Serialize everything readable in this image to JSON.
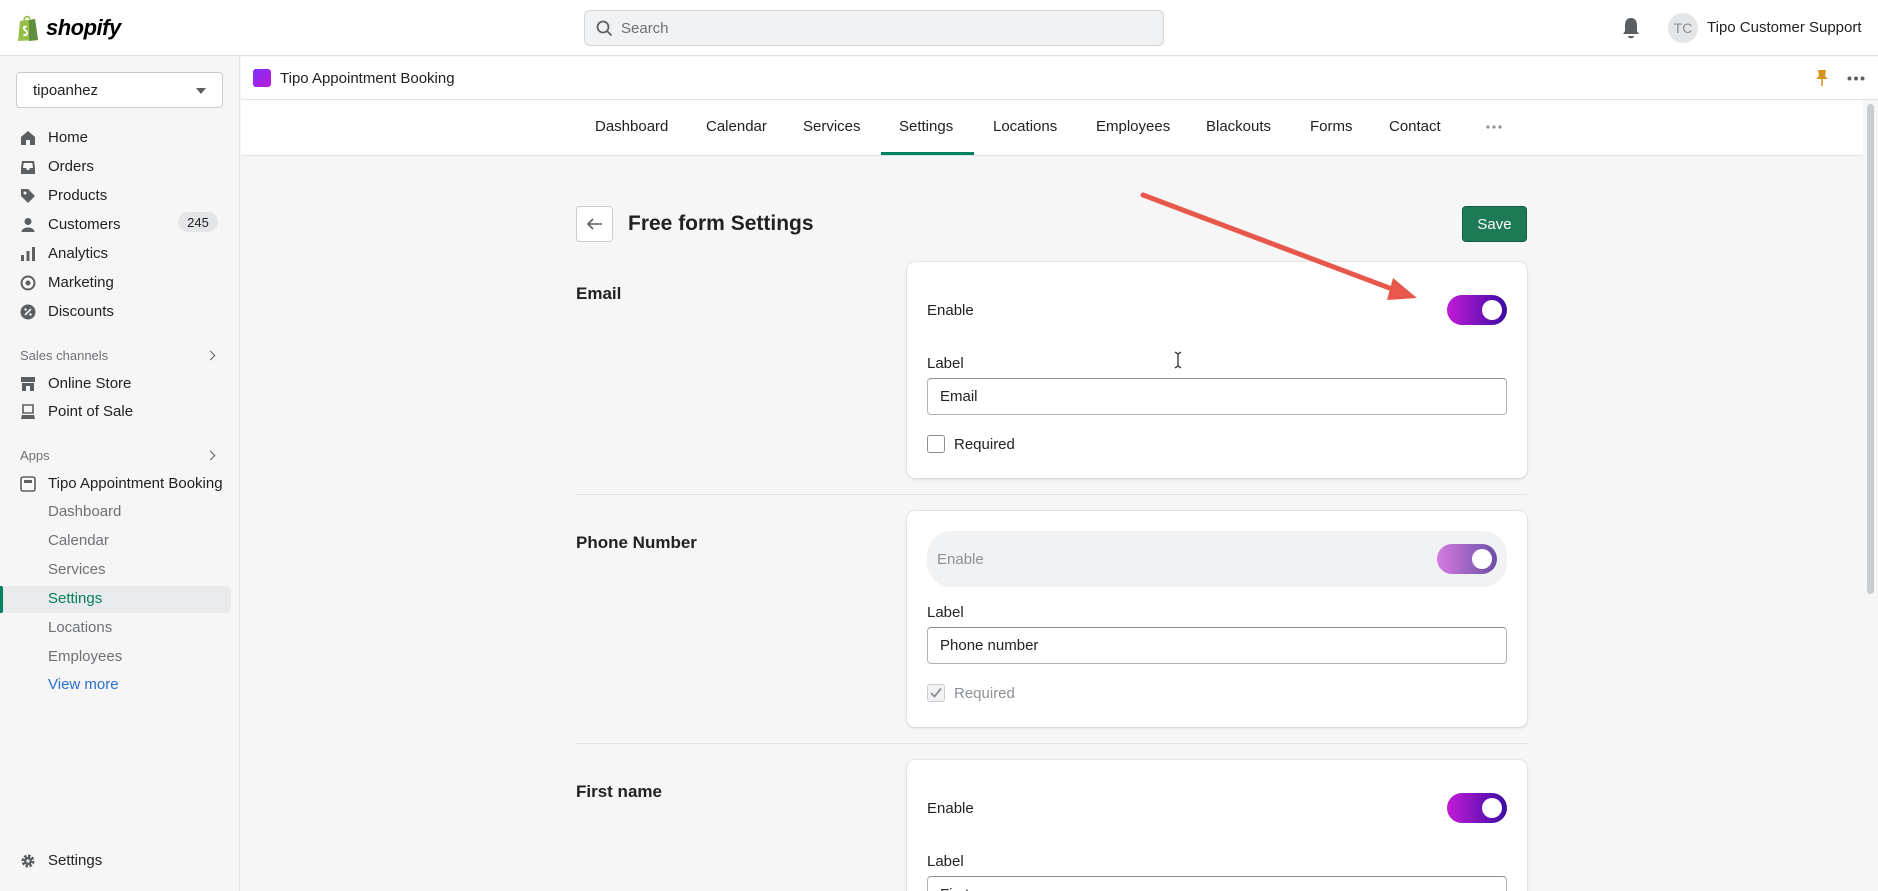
{
  "topbar": {
    "brand": "shopify",
    "search_placeholder": "Search",
    "avatar_initials": "TC",
    "account_name": "Tipo Customer Support"
  },
  "sidebar": {
    "store": "tipoanhez",
    "main_items": [
      {
        "label": "Home",
        "icon": "home-icon"
      },
      {
        "label": "Orders",
        "icon": "orders-icon",
        "badge": "245"
      },
      {
        "label": "Products",
        "icon": "tag-icon"
      },
      {
        "label": "Customers",
        "icon": "person-icon"
      },
      {
        "label": "Analytics",
        "icon": "bar-chart-icon"
      },
      {
        "label": "Marketing",
        "icon": "target-icon"
      },
      {
        "label": "Discounts",
        "icon": "discount-icon"
      }
    ],
    "sales_channels_label": "Sales channels",
    "sales_channels": [
      {
        "label": "Online Store",
        "icon": "store-icon"
      },
      {
        "label": "Point of Sale",
        "icon": "pos-icon"
      }
    ],
    "apps_label": "Apps",
    "app_name": "Tipo Appointment Booking",
    "app_sub_items": [
      "Dashboard",
      "Calendar",
      "Services",
      "Settings",
      "Locations",
      "Employees"
    ],
    "active_sub_item": "Settings",
    "view_more": "View more",
    "settings": "Settings"
  },
  "app_header": {
    "title": "Tipo Appointment Booking"
  },
  "tabs": [
    "Dashboard",
    "Calendar",
    "Services",
    "Settings",
    "Locations",
    "Employees",
    "Blackouts",
    "Forms",
    "Contact"
  ],
  "active_tab": "Settings",
  "page": {
    "title": "Free form Settings",
    "save_label": "Save",
    "enable_label": "Enable",
    "label_label": "Label",
    "required_label": "Required",
    "sections": [
      {
        "title": "Email",
        "label_value": "Email",
        "enabled": true,
        "required": false,
        "locked": false
      },
      {
        "title": "Phone Number",
        "label_value": "Phone number",
        "enabled": true,
        "required": true,
        "locked": true
      },
      {
        "title": "First name",
        "label_value": "First name",
        "enabled": true,
        "required": false,
        "locked": false
      }
    ]
  },
  "colors": {
    "accent_green": "#008060",
    "save_green": "#1e7a55",
    "toggle_start": "#c21bd8",
    "toggle_end": "#3a0ca3",
    "annotation_arrow": "#e8574b"
  }
}
